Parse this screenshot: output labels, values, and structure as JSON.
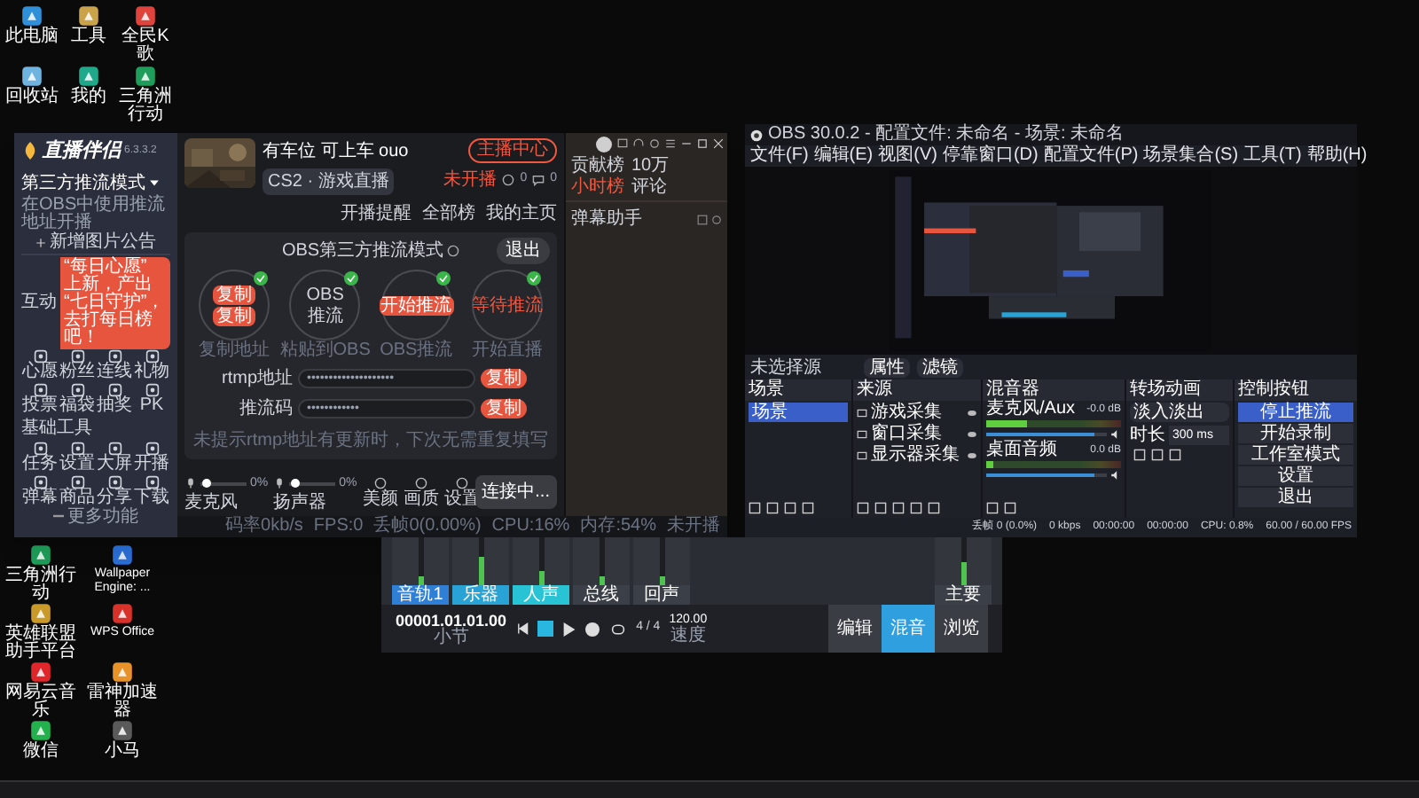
{
  "desktop_icons_top": [
    {
      "label": "此电脑",
      "color": "#2f8fd8"
    },
    {
      "label": "工具",
      "color": "#c9a24a"
    },
    {
      "label": "全民K歌",
      "color": "#e0433b"
    },
    {
      "label": "回收站",
      "color": "#6fb3e0"
    },
    {
      "label": "我的",
      "color": "#1fa88a"
    },
    {
      "label": "三角洲行动",
      "color": "#1e9e5a"
    }
  ],
  "desktop_icons_bottom": [
    {
      "label": "三角洲行动",
      "color": "#1e9e5a"
    },
    {
      "label": "Wallpaper Engine: ...",
      "color": "#2a6fd8"
    },
    {
      "label": "英雄联盟助手平台",
      "color": "#c99a2a"
    },
    {
      "label": "WPS Office",
      "color": "#d8322b"
    },
    {
      "label": "网易云音乐",
      "color": "#e0262b"
    },
    {
      "label": "雷神加速器",
      "color": "#e8922a"
    },
    {
      "label": "微信",
      "color": "#22b14c"
    },
    {
      "label": "小马",
      "color": "#5a5a5a"
    }
  ],
  "live_app": {
    "logo": "直播伴侣",
    "version": "6.3.3.2",
    "mode": "第三方推流模式",
    "mode_hint": "在OBS中使用推流地址开播",
    "add_button": "新增图片公告",
    "section_interact": "互动",
    "banner": "“每日心愿” 上新，产出 “七日守护”，去打每日榜吧！",
    "interact_tools": [
      "心愿",
      "粉丝",
      "连线",
      "礼物",
      "投票",
      "福袋",
      "抽奖",
      "PK"
    ],
    "section_tools": "基础工具",
    "basic_tools": [
      "任务",
      "设置",
      "大屏",
      "开播",
      "弹幕",
      "商品",
      "分享",
      "下载"
    ],
    "more": "更多功能",
    "streamer": "有车位 可上车 ouo",
    "category": "CS2 · 游戏直播",
    "center_button": "主播中心",
    "links": [
      "开播提醒",
      "全部榜",
      "我的主页"
    ],
    "live_state": "未开播",
    "likes": "0",
    "comments": "0",
    "flow_title": "OBS第三方推流模式",
    "exit_button": "退出",
    "steps": [
      {
        "kind": "copy",
        "texts": [
          "复制",
          "复制"
        ],
        "caption": "复制地址",
        "done": true
      },
      {
        "kind": "plain",
        "texts": [
          "OBS",
          "推流"
        ],
        "caption": "粘贴到OBS",
        "done": true
      },
      {
        "kind": "button",
        "texts": [
          "开始推流"
        ],
        "caption": "OBS推流",
        "done": true
      },
      {
        "kind": "status",
        "texts": [
          "等待推流"
        ],
        "caption": "开始直播",
        "done": true
      }
    ],
    "fields": [
      {
        "label": "rtmp地址",
        "value": "••••••••••••••••••••",
        "button": "复制"
      },
      {
        "label": "推流码",
        "value": "••••••••••••",
        "button": "复制"
      }
    ],
    "note": "未提示rtmp地址有更新时，下次无需重复填写",
    "audio": [
      {
        "label": "麦克风",
        "level": 0.05,
        "reading": "0%"
      },
      {
        "label": "扬声器",
        "level": 0.05,
        "reading": "0%"
      }
    ],
    "tools": [
      "美颜",
      "画质",
      "设置"
    ],
    "start_button": "连接中...",
    "status": [
      "码率0kb/s",
      "FPS:0",
      "丢帧0(0.00%)",
      "CPU:16%",
      "内存:54%",
      "未开播"
    ],
    "side_tabs": [
      {
        "label": "贡献榜",
        "selected": false
      },
      {
        "label": "10万",
        "selected": false
      },
      {
        "label": "小时榜",
        "selected": true
      },
      {
        "label": "评论",
        "selected": false
      }
    ],
    "side_title": "弹幕助手"
  },
  "obs": {
    "title": "OBS 30.0.2 - 配置文件: 未命名 - 场景: 未命名",
    "menu": [
      "文件(F)",
      "编辑(E)",
      "视图(V)",
      "停靠窗口(D)",
      "配置文件(P)",
      "场景集合(S)",
      "工具(T)",
      "帮助(H)"
    ],
    "source_bar": "未选择源",
    "source_buttons": [
      "属性",
      "滤镜"
    ],
    "docks": [
      "场景",
      "来源",
      "混音器",
      "转场动画",
      "控制按钮"
    ],
    "scenes": [
      {
        "label": "场景",
        "selected": true
      }
    ],
    "sources": [
      {
        "label": "游戏采集"
      },
      {
        "label": "窗口采集"
      },
      {
        "label": "显示器采集"
      }
    ],
    "mixer": [
      {
        "name": "麦克风/Aux",
        "reading": "-0.0 dB",
        "level": 0.3,
        "fader": {
          "level": 0.9
        }
      },
      {
        "name": "桌面音频",
        "reading": "0.0 dB",
        "level": 0.05,
        "fader": {
          "level": 0.9
        }
      }
    ],
    "transition": "淡入淡出",
    "duration_label": "时长",
    "duration": "300 ms",
    "controls": [
      {
        "label": "停止推流",
        "selected": true
      },
      {
        "label": "开始录制",
        "selected": false
      },
      {
        "label": "工作室模式",
        "selected": false
      },
      {
        "label": "设置",
        "selected": false
      },
      {
        "label": "退出",
        "selected": false
      }
    ],
    "status": [
      "丢帧 0 (0.0%)",
      "0 kbps",
      "00:00:00",
      "00:00:00",
      "CPU: 0.8%",
      "60.00 / 60.00 FPS"
    ]
  },
  "daw": {
    "strips": [
      {
        "name": "音轨1",
        "color": "#2f7fd6",
        "level": 0.2
      },
      {
        "name": "乐器",
        "color": "#29a3d6",
        "level": 0.6
      },
      {
        "name": "人声",
        "color": "#29c3d6",
        "level": 0.3
      },
      {
        "name": "总线",
        "color": "#3a3f48",
        "level": 0.2
      },
      {
        "name": "回声",
        "color": "#3a3f48",
        "level": 0.2
      },
      {
        "name": "主要",
        "color": "#3a3f48",
        "level": 0.5
      }
    ],
    "time": "00001.01.01.00",
    "time_unit": "小节",
    "signature": "4 / 4",
    "tempo": "120.00",
    "tempo_label": "速度",
    "tabs": [
      {
        "label": "编辑",
        "selected": false
      },
      {
        "label": "混音",
        "selected": true
      },
      {
        "label": "浏览",
        "selected": false
      }
    ]
  }
}
